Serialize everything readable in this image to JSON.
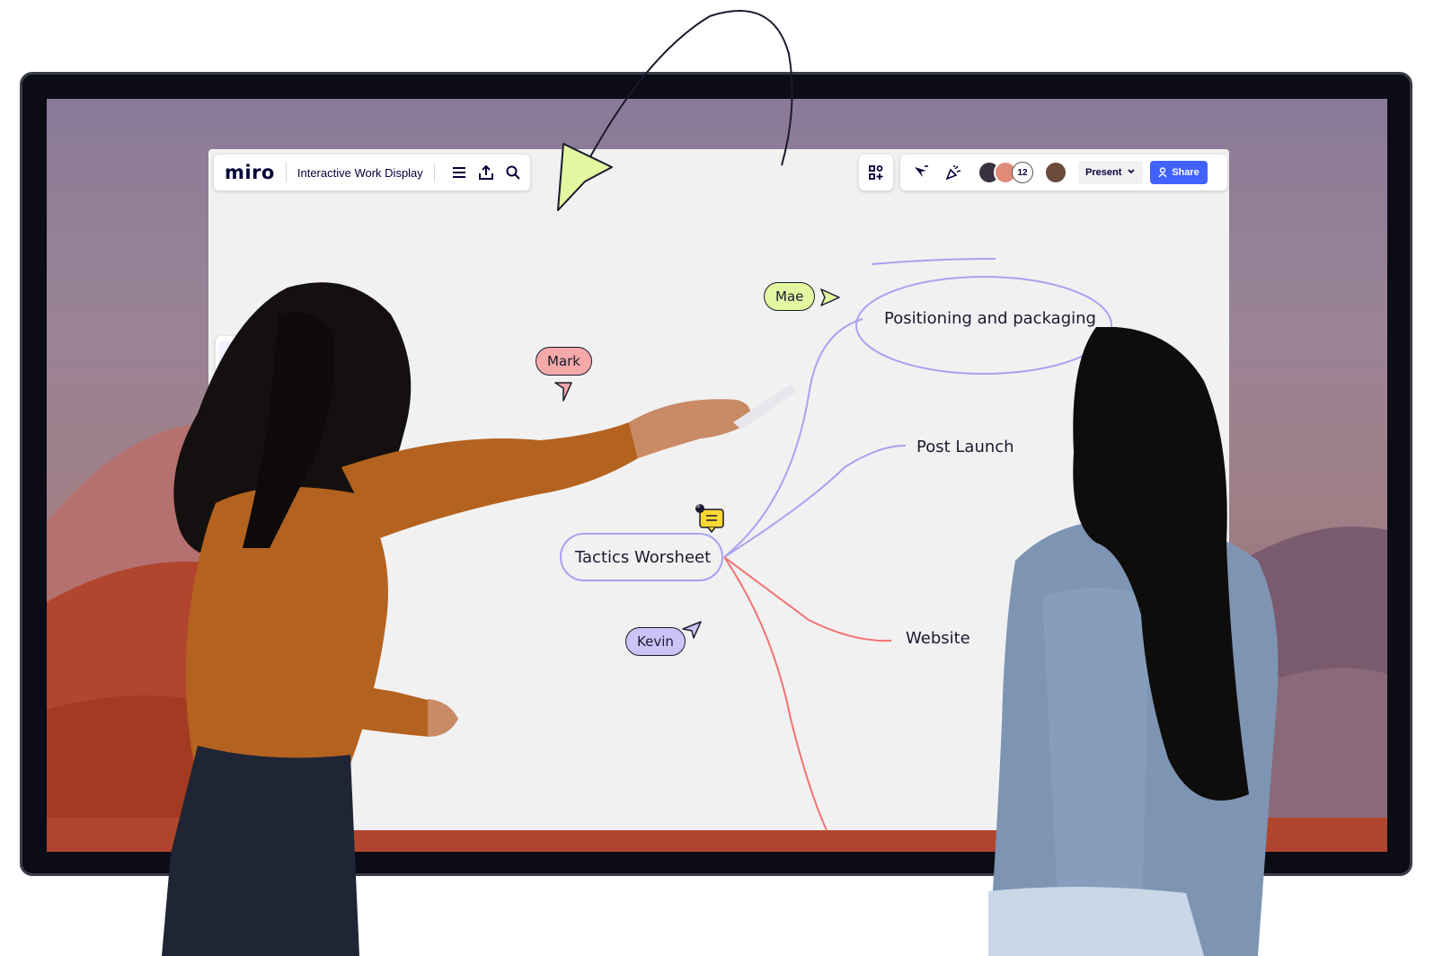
{
  "app": {
    "logo": "miro",
    "board_title": "Interactive Work Display"
  },
  "toolbar": {
    "left_icons": [
      "menu-icon",
      "export-icon",
      "search-icon"
    ],
    "right_icons": [
      "apps-icon",
      "cursor-icon",
      "reaction-icon"
    ],
    "collaborators_count": "12",
    "present_label": "Present",
    "share_label": "Share",
    "accent": "#4262ff"
  },
  "side_tools": [
    "select-icon",
    "text-icon",
    "sticky-note-icon",
    "shape-icon"
  ],
  "mindmap": {
    "root": "Tactics Worsheet",
    "children": [
      "Positioning and packaging",
      "Post Launch",
      "Website"
    ],
    "comment_count": "3",
    "line_colors": {
      "purple": "#a9a2f0",
      "red": "#f27272"
    }
  },
  "cursors": [
    {
      "name": "Mae",
      "color": "#e4f7a0"
    },
    {
      "name": "Mark",
      "color": "#f5a9a9"
    },
    {
      "name": "Kevin",
      "color": "#cbc4f7"
    }
  ]
}
